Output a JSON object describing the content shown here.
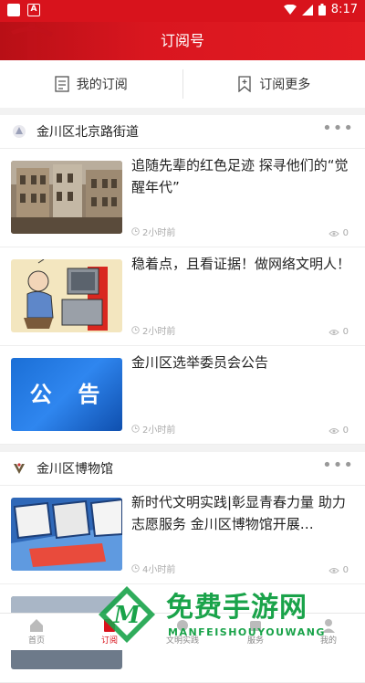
{
  "status_bar": {
    "time": "8:17"
  },
  "header": {
    "title": "订阅号"
  },
  "tabs": [
    {
      "label": "我的订阅"
    },
    {
      "label": "订阅更多"
    }
  ],
  "sections": [
    {
      "name": "金川区北京路街道",
      "items": [
        {
          "title": "追随先辈的红色足迹 探寻他们的“觉醒年代”",
          "time": "2小时前",
          "views": "0"
        },
        {
          "title": "稳着点，且看证据！做网络文明人！",
          "time": "2小时前",
          "views": "0"
        },
        {
          "title": "金川区选举委员会公告",
          "time": "2小时前",
          "views": "0",
          "thumb_text": "公  告"
        }
      ]
    },
    {
      "name": "金川区博物馆",
      "items": [
        {
          "title": "新时代文明实践|彰显青春力量 助力志愿服务 金川区博物馆开展…",
          "time": "4小时前",
          "views": "0"
        }
      ]
    }
  ],
  "bottom_nav": [
    {
      "label": "首页",
      "icon": "home-icon"
    },
    {
      "label": "订阅",
      "icon": "subscribe-icon"
    },
    {
      "label": "文明实践",
      "icon": "practice-icon"
    },
    {
      "label": "服务",
      "icon": "service-icon"
    },
    {
      "label": "我的",
      "icon": "profile-icon"
    }
  ],
  "watermark": {
    "title": "免费手游网",
    "subtitle": "MANFEISHOUYOUWANG"
  },
  "colors": {
    "brand_red": "#d8131c",
    "watermark_green": "#1aa34a"
  }
}
